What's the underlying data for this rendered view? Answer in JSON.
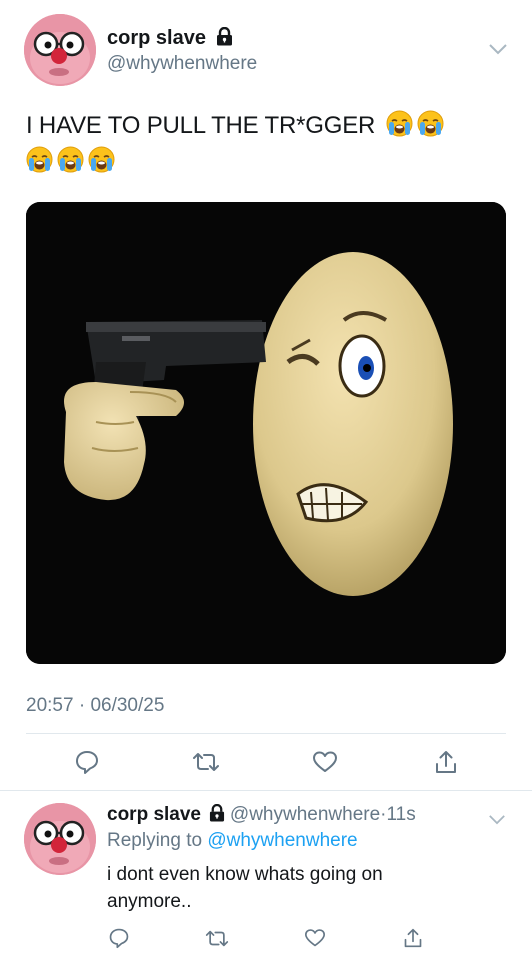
{
  "tweet": {
    "display_name": "corp slave",
    "handle": "@whywhenwhere",
    "text": "I HAVE TO PULL THE TR*GGER",
    "emoji_name": "loudly-crying-face",
    "emoji_count_line1": 2,
    "emoji_count_line2": 3,
    "time": "20:57",
    "separator": "·",
    "date": "06/30/25",
    "media_description": "cartoon emoji holding a pistol to its head"
  },
  "actions": [
    "reply-icon",
    "retweet-icon",
    "like-icon",
    "share-icon"
  ],
  "reply": {
    "display_name": "corp slave",
    "handle": "@whywhenwhere",
    "separator": "·",
    "age": "11s",
    "replying_prefix": "Replying to",
    "replying_to": "@whywhenwhere",
    "text": "i dont even know whats going on anymore.."
  },
  "colors": {
    "link": "#1da1f2",
    "secondary_text": "#657786",
    "divider": "#e1e8ed",
    "media_bg": "#060606"
  }
}
